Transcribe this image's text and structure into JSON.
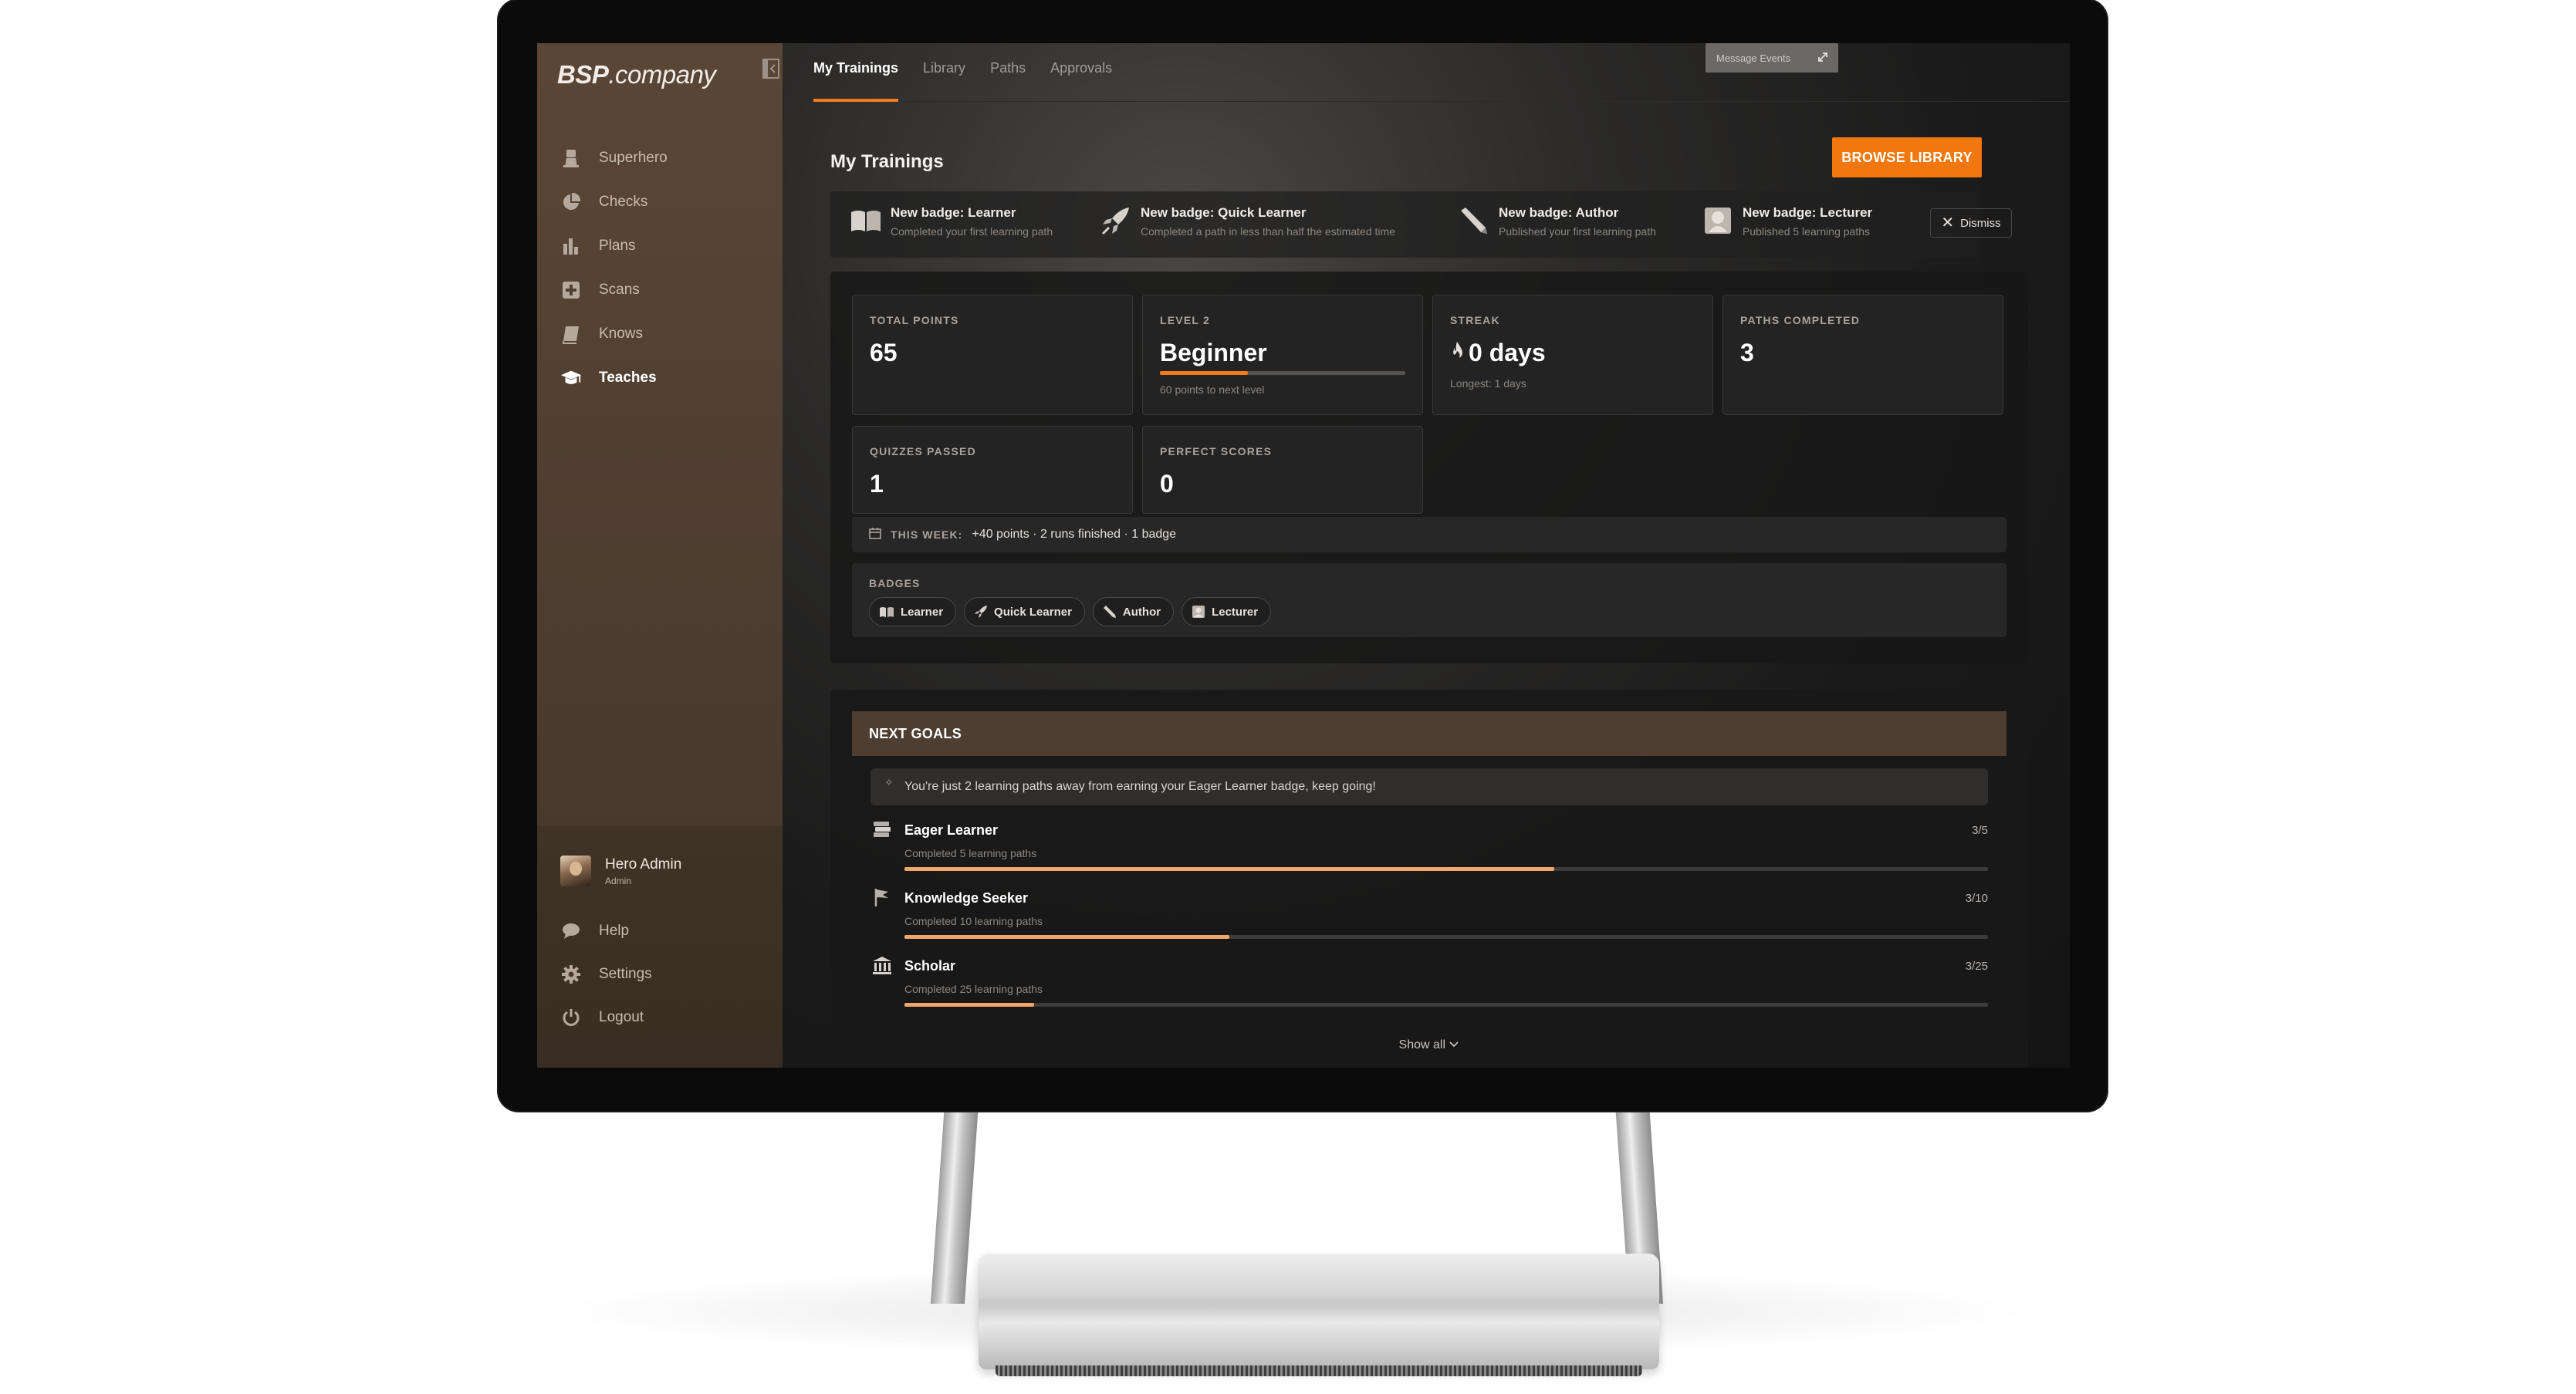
{
  "app": {
    "brand_bold": "BSP",
    "brand_rest": ".company"
  },
  "sidebar": {
    "items": [
      {
        "label": "Superhero",
        "icon": "hero-icon"
      },
      {
        "label": "Checks",
        "icon": "pie-icon"
      },
      {
        "label": "Plans",
        "icon": "bar-chart-icon"
      },
      {
        "label": "Scans",
        "icon": "plus-square-icon"
      },
      {
        "label": "Knows",
        "icon": "book-icon"
      },
      {
        "label": "Teaches",
        "icon": "graduation-cap-icon",
        "active": true
      }
    ],
    "user": {
      "name": "Hero Admin",
      "role": "Admin"
    },
    "bottom_items": [
      {
        "label": "Help",
        "icon": "chat-bubble-icon"
      },
      {
        "label": "Settings",
        "icon": "gear-icon"
      },
      {
        "label": "Logout",
        "icon": "power-icon"
      }
    ]
  },
  "topbar": {
    "tabs": [
      "My Trainings",
      "Library",
      "Paths",
      "Approvals"
    ],
    "active_tab": "My Trainings",
    "message_events": "Message Events"
  },
  "main": {
    "title": "My Trainings",
    "browse_button": "BROWSE LIBRARY",
    "new_badges": [
      {
        "title": "New badge: Learner",
        "subtitle": "Completed your first learning path",
        "icon": "book-icon"
      },
      {
        "title": "New badge: Quick Learner",
        "subtitle": "Completed a path in less than half the estimated time",
        "icon": "rocket-icon"
      },
      {
        "title": "New badge: Author",
        "subtitle": "Published your first learning path",
        "icon": "pencil-icon"
      },
      {
        "title": "New badge: Lecturer",
        "subtitle": "Published 5 learning paths",
        "icon": "lecturer-icon"
      }
    ],
    "dismiss": "Dismiss",
    "stats": {
      "total_points": {
        "label": "TOTAL POINTS",
        "value": "65"
      },
      "level": {
        "label": "LEVEL 2",
        "value": "Beginner",
        "sub": "60 points to next level",
        "progress": 0.36
      },
      "streak": {
        "label": "STREAK",
        "value": "0 days",
        "sub": "Longest: 1 days"
      },
      "paths_completed": {
        "label": "PATHS COMPLETED",
        "value": "3"
      },
      "quizzes_passed": {
        "label": "QUIZZES PASSED",
        "value": "1"
      },
      "perfect_scores": {
        "label": "PERFECT SCORES",
        "value": "0"
      }
    },
    "this_week": {
      "label": "THIS WEEK:",
      "text": "+40 points · 2 runs finished · 1 badge"
    },
    "badges": {
      "label": "BADGES",
      "items": [
        {
          "label": "Learner",
          "icon": "book-icon"
        },
        {
          "label": "Quick Learner",
          "icon": "rocket-icon"
        },
        {
          "label": "Author",
          "icon": "pencil-icon"
        },
        {
          "label": "Lecturer",
          "icon": "lecturer-icon"
        }
      ]
    },
    "next_goals": {
      "title": "NEXT GOALS",
      "hint": "You're just 2 learning paths away from earning your Eager Learner badge, keep going!",
      "goals": [
        {
          "name": "Eager Learner",
          "desc": "Completed 5 learning paths",
          "count": "3/5",
          "progress": 0.6,
          "icon": "books-icon"
        },
        {
          "name": "Knowledge Seeker",
          "desc": "Completed 10 learning paths",
          "count": "3/10",
          "progress": 0.3,
          "icon": "flag-icon"
        },
        {
          "name": "Scholar",
          "desc": "Completed 25 learning paths",
          "count": "3/25",
          "progress": 0.12,
          "icon": "building-icon"
        }
      ],
      "show_all": "Show all"
    }
  }
}
